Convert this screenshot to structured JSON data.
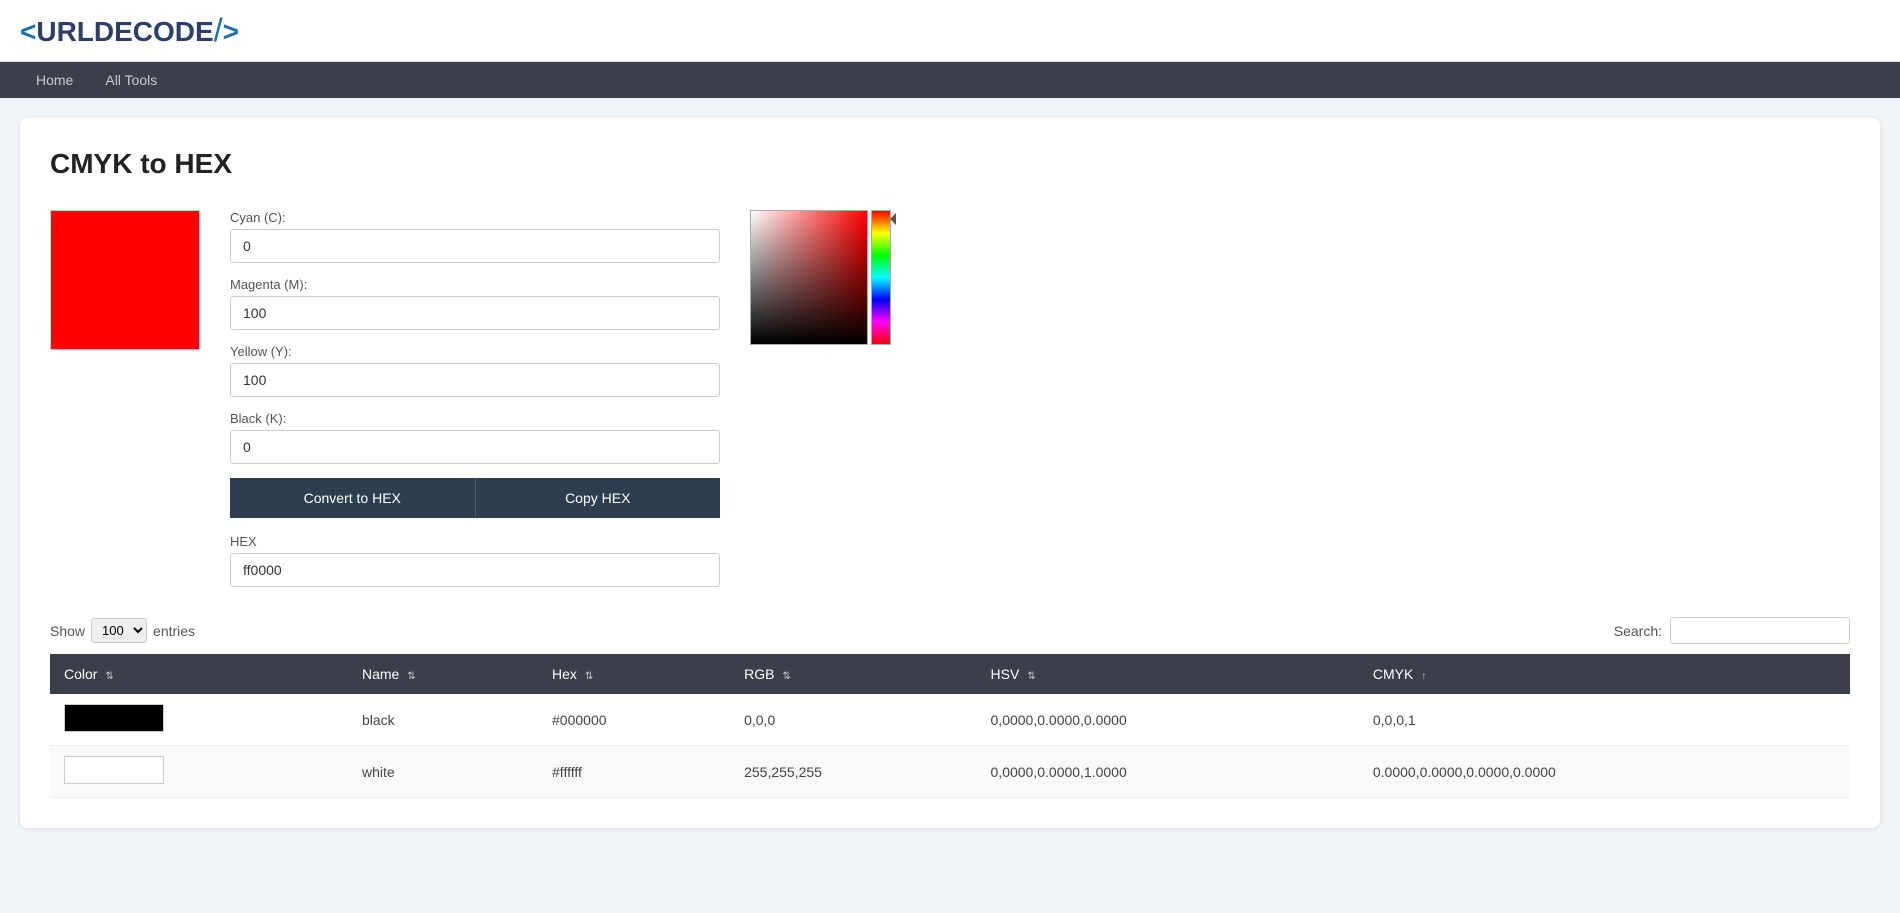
{
  "logo": {
    "text": "<URLDECODE/>"
  },
  "nav": {
    "items": [
      {
        "label": "Home",
        "href": "#"
      },
      {
        "label": "All Tools",
        "href": "#"
      }
    ]
  },
  "page": {
    "title": "CMYK to HEX"
  },
  "tool": {
    "cyan_label": "Cyan (C):",
    "cyan_value": "0",
    "magenta_label": "Magenta (M):",
    "magenta_value": "100",
    "yellow_label": "Yellow (Y):",
    "yellow_value": "100",
    "black_label": "Black (K):",
    "black_value": "0",
    "convert_button": "Convert to HEX",
    "copy_button": "Copy HEX",
    "hex_label": "HEX",
    "hex_value": "ff0000"
  },
  "table": {
    "show_label": "Show",
    "entries_label": "entries",
    "show_value": "100",
    "search_label": "Search:",
    "search_placeholder": "",
    "columns": [
      {
        "label": "Color",
        "key": "color"
      },
      {
        "label": "Name",
        "key": "name"
      },
      {
        "label": "Hex",
        "key": "hex"
      },
      {
        "label": "RGB",
        "key": "rgb"
      },
      {
        "label": "HSV",
        "key": "hsv"
      },
      {
        "label": "CMYK",
        "key": "cmyk"
      }
    ],
    "rows": [
      {
        "color_bg": "#000000",
        "name": "black",
        "hex": "#000000",
        "rgb": "0,0,0",
        "hsv": "0,0000,0.0000,0.0000",
        "cmyk": "0,0,0,1"
      },
      {
        "color_bg": "#ffffff",
        "name": "white",
        "hex": "#ffffff",
        "rgb": "255,255,255",
        "hsv": "0,0000,0.0000,1.0000",
        "cmyk": "0.0000,0.0000,0.0000,0.0000"
      }
    ]
  }
}
